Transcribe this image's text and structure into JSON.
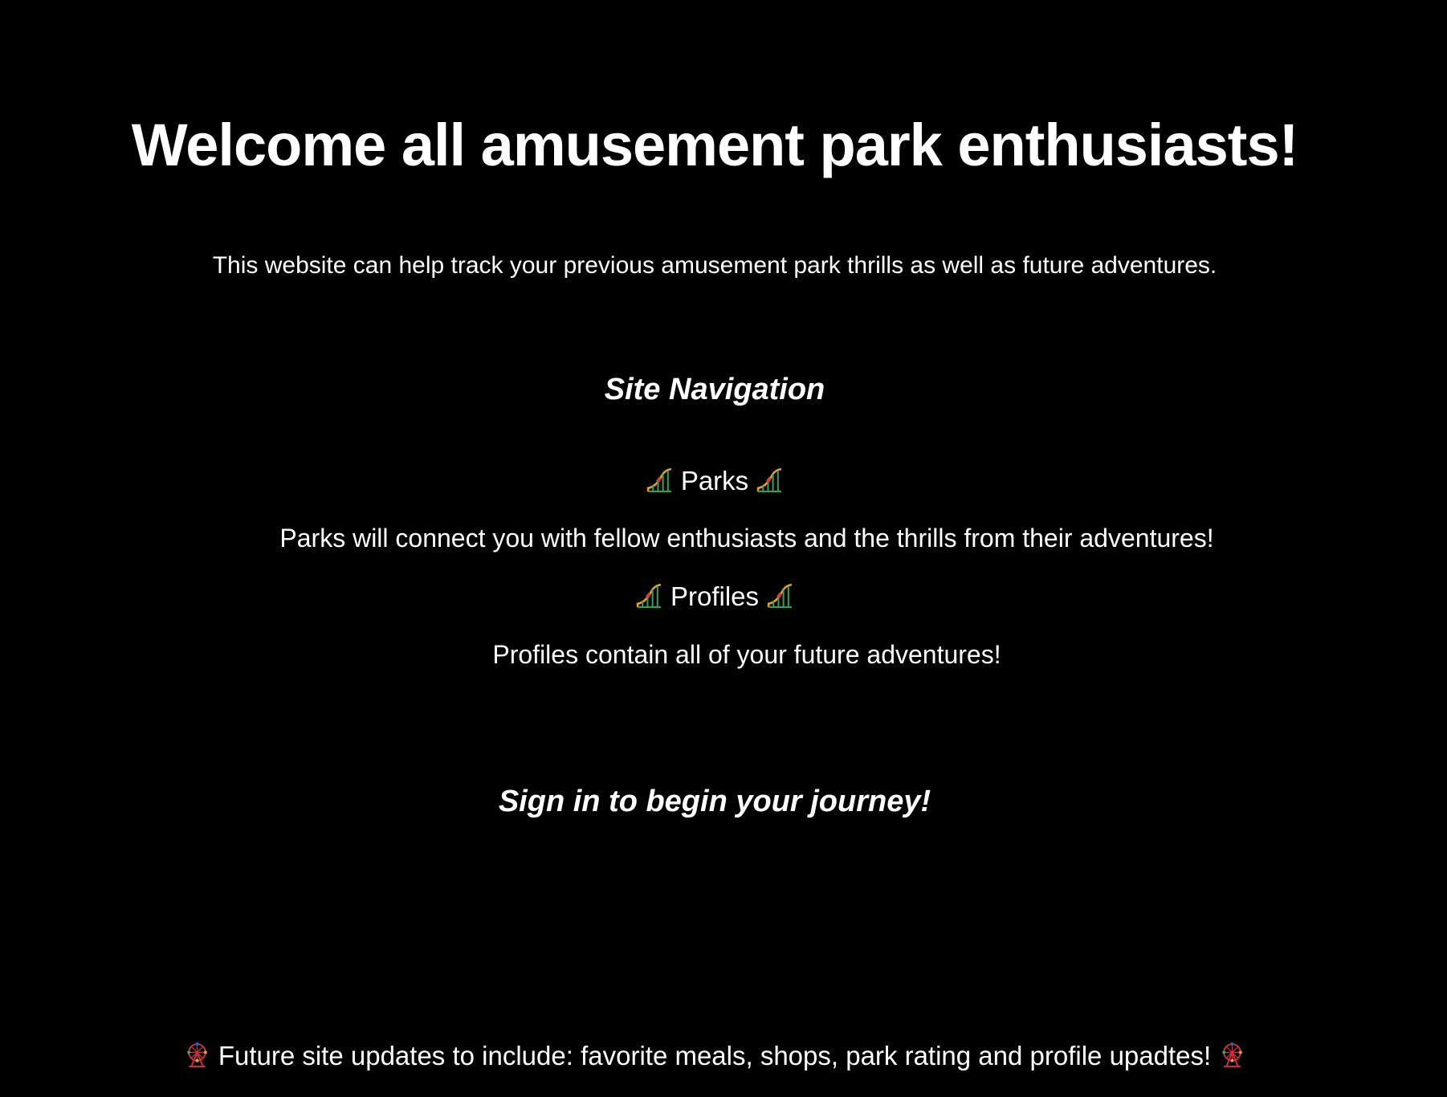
{
  "title": "Welcome all amusement park enthusiasts!",
  "intro": "This website can help track your previous amusement park thrills as well as future adventures.",
  "navigation": {
    "heading": "Site Navigation",
    "links": [
      {
        "label": "Parks",
        "icon": "roller-coaster-icon",
        "description": "Parks will connect you with fellow enthusiasts and the thrills from their adventures!"
      },
      {
        "label": "Profiles",
        "icon": "roller-coaster-icon",
        "description": "Profiles contain all of your future adventures!"
      }
    ]
  },
  "signin_prompt": "Sign in to begin your journey!",
  "footer": {
    "text": "Future site updates to include: favorite meals, shops, park rating and profile upadtes!",
    "icon": "ferris-wheel-icon"
  },
  "colors": {
    "background": "#000000",
    "text": "#ffffff"
  }
}
